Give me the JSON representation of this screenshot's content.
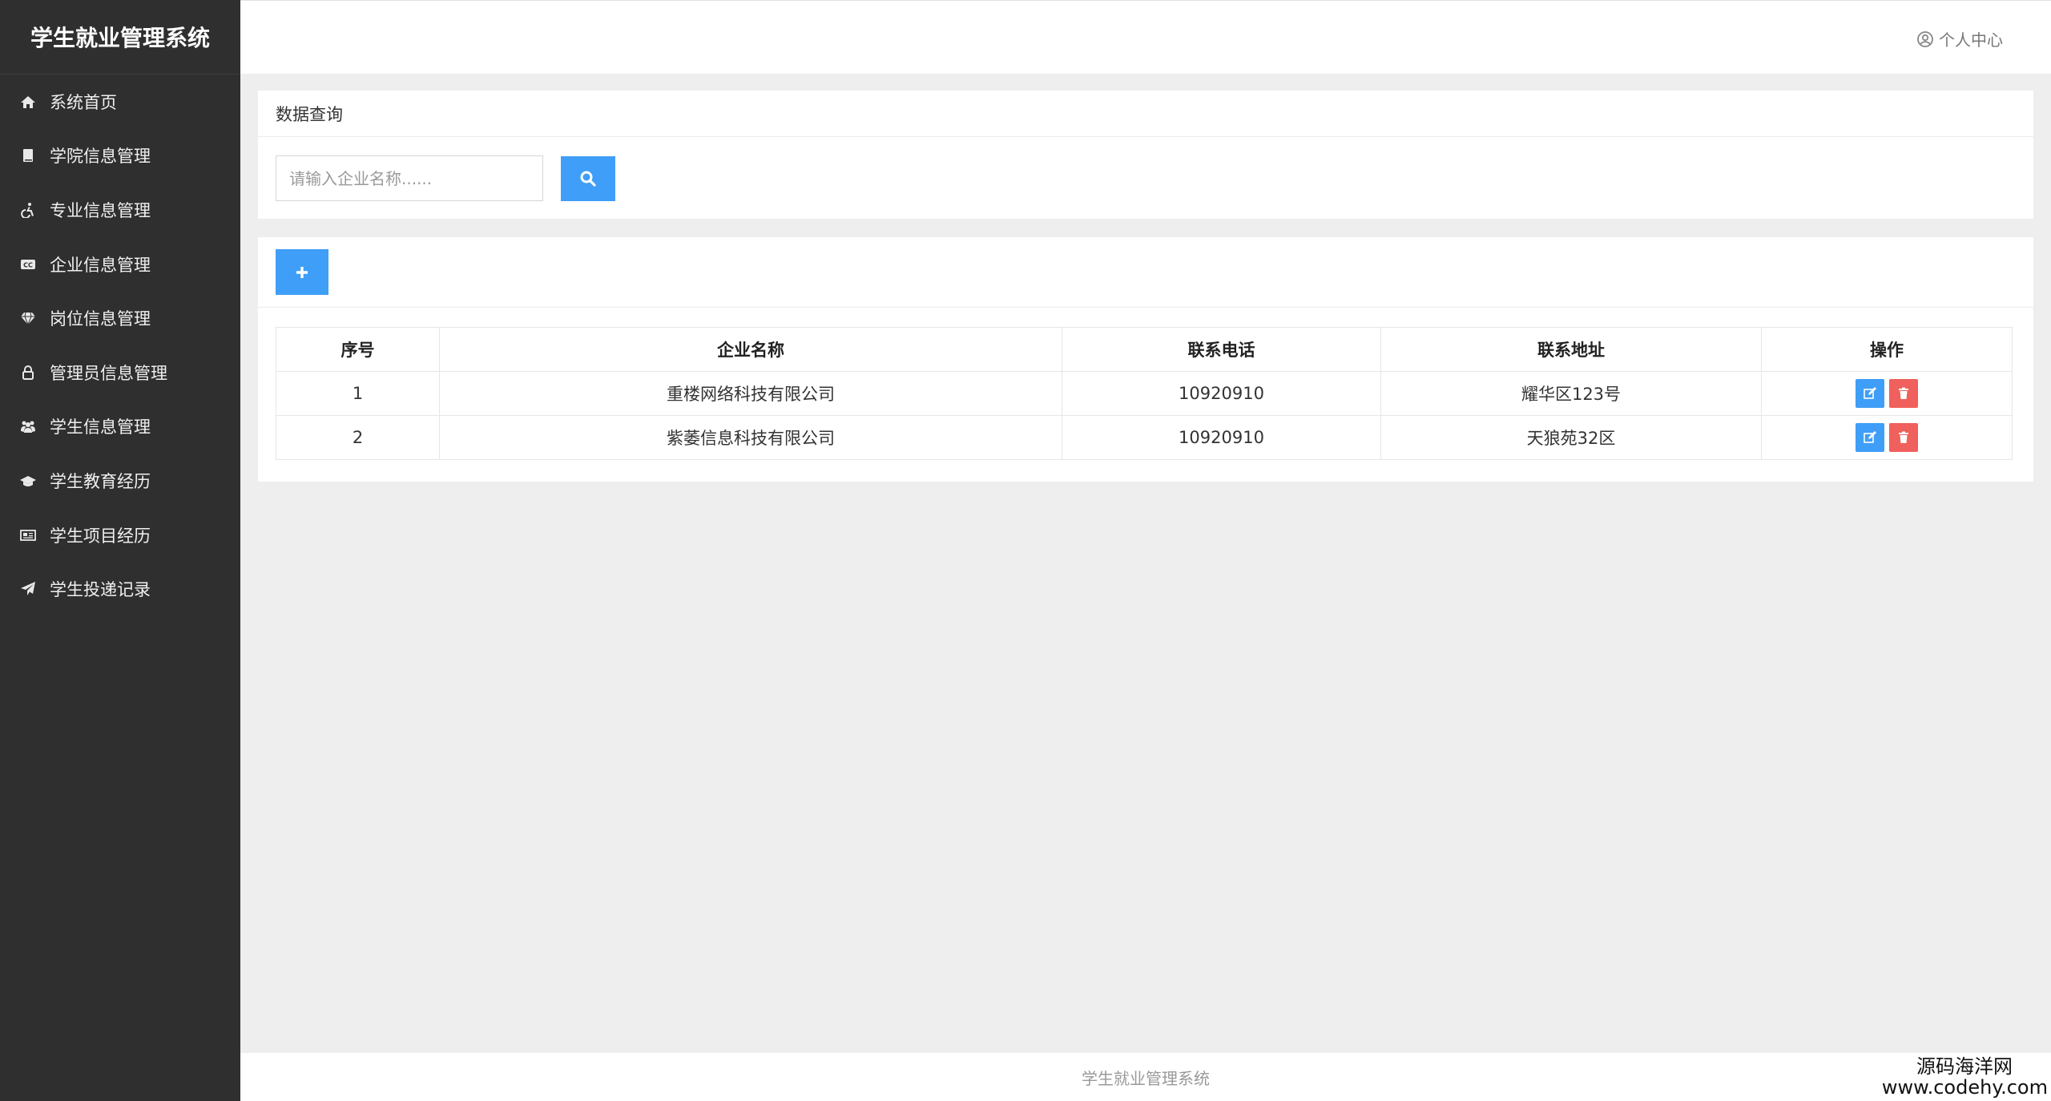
{
  "app": {
    "title": "学生就业管理系统"
  },
  "sidebar": {
    "items": [
      {
        "label": "系统首页",
        "icon": "home-icon"
      },
      {
        "label": "学院信息管理",
        "icon": "book-icon"
      },
      {
        "label": "专业信息管理",
        "icon": "wheelchair-icon"
      },
      {
        "label": "企业信息管理",
        "icon": "cc-icon"
      },
      {
        "label": "岗位信息管理",
        "icon": "diamond-icon"
      },
      {
        "label": "管理员信息管理",
        "icon": "lock-icon"
      },
      {
        "label": "学生信息管理",
        "icon": "users-icon"
      },
      {
        "label": "学生教育经历",
        "icon": "graduation-cap-icon"
      },
      {
        "label": "学生项目经历",
        "icon": "newspaper-icon"
      },
      {
        "label": "学生投递记录",
        "icon": "paper-plane-icon"
      }
    ]
  },
  "header": {
    "user_center": "个人中心"
  },
  "query": {
    "title": "数据查询",
    "placeholder": "请输入企业名称......",
    "value": ""
  },
  "table": {
    "columns": [
      "序号",
      "企业名称",
      "联系电话",
      "联系地址",
      "操作"
    ],
    "rows": [
      {
        "index": "1",
        "name": "重楼网络科技有限公司",
        "phone": "10920910",
        "address": "耀华区123号"
      },
      {
        "index": "2",
        "name": "紫萎信息科技有限公司",
        "phone": "10920910",
        "address": "天狼苑32区"
      }
    ]
  },
  "footer": {
    "text": "学生就业管理系统"
  },
  "watermark": {
    "line1": "源码海洋网",
    "line2": "www.codehy.com"
  },
  "colors": {
    "sidebar": "#2f2f2f",
    "primary": "#3f9ef7",
    "danger": "#f0605c",
    "background": "#eeeeee"
  }
}
